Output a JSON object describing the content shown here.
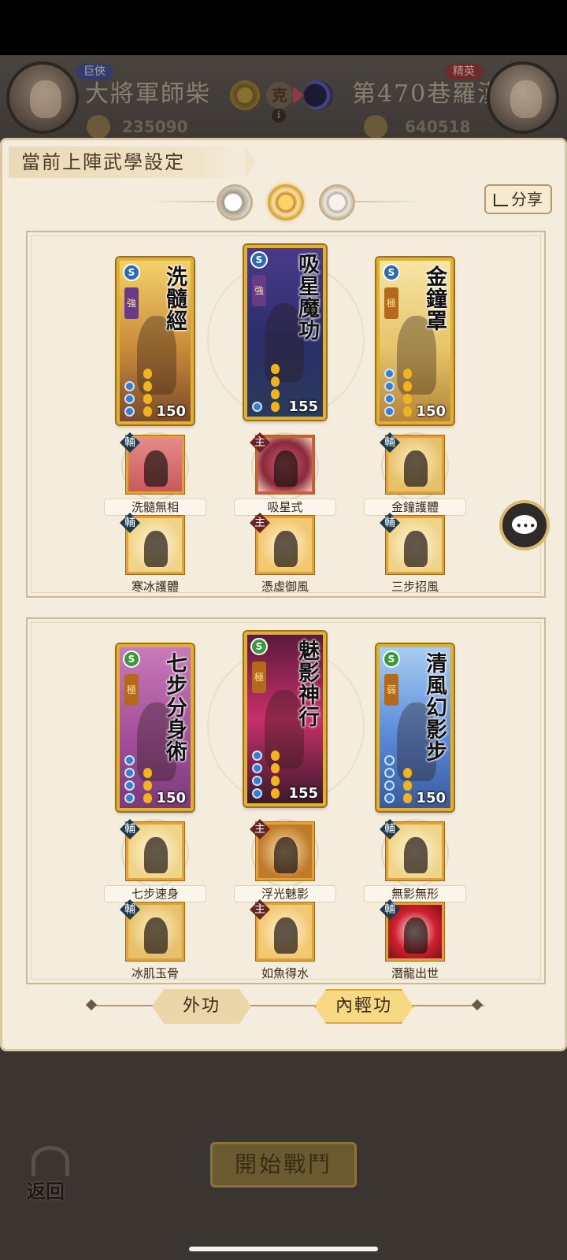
{
  "header": {
    "left_player": {
      "badge": "巨俠",
      "name": "大將軍師柴",
      "power": "235090"
    },
    "right_player": {
      "badge": "精英",
      "name": "第470巷羅漢",
      "power": "640518"
    },
    "counter_char": "克",
    "info": "i"
  },
  "panel": {
    "title": "當前上陣武學設定",
    "share_label": "分享",
    "slots": [
      "moon-slot",
      "sun-slot",
      "ring-slot"
    ],
    "groups": [
      {
        "cards": [
          {
            "name": "洗髓經",
            "type": "S",
            "grade": "強",
            "power": "150",
            "pips": 3,
            "gourds": 4
          },
          {
            "name": "吸星魔功",
            "type": "S",
            "grade": "強",
            "power": "155",
            "pips": 1,
            "gourds": 4
          },
          {
            "name": "金鐘罩",
            "type": "S",
            "grade": "極",
            "power": "150",
            "pips": 4,
            "gourds": 4
          }
        ],
        "subs_row1": [
          {
            "tag": "輔",
            "label": "洗髓無相"
          },
          {
            "tag": "主",
            "label": "吸星式"
          },
          {
            "tag": "輔",
            "label": "金鐘護體"
          }
        ],
        "subs_row2": [
          {
            "tag": "輔",
            "label": "寒冰護體"
          },
          {
            "tag": "主",
            "label": "憑虛御風"
          },
          {
            "tag": "輔",
            "label": "三步招風"
          }
        ]
      },
      {
        "cards": [
          {
            "name": "七步分身術",
            "type": "S",
            "grade": "極",
            "power": "150",
            "pips": 4,
            "gourds": 3
          },
          {
            "name": "魅影神行",
            "type": "S",
            "grade": "極",
            "power": "155",
            "pips": 4,
            "gourds": 4
          },
          {
            "name": "清風幻影步",
            "type": "S",
            "grade": "弱",
            "power": "150",
            "pips": 4,
            "gourds": 3
          }
        ],
        "subs_row1": [
          {
            "tag": "輔",
            "label": "七步速身"
          },
          {
            "tag": "主",
            "label": "浮光魅影"
          },
          {
            "tag": "輔",
            "label": "無影無形"
          }
        ],
        "subs_row2": [
          {
            "tag": "輔",
            "label": "冰肌玉骨"
          },
          {
            "tag": "主",
            "label": "如魚得水"
          },
          {
            "tag": "輔",
            "label": "潛龍出世"
          }
        ]
      }
    ],
    "tabs": {
      "outer": "外功",
      "inner": "內輕功"
    }
  },
  "footer": {
    "start_label": "開始戰鬥",
    "back_label": "返回"
  },
  "colors": {
    "accent_gold": "#e0b030",
    "panel_bg": "#f4ecdd"
  }
}
